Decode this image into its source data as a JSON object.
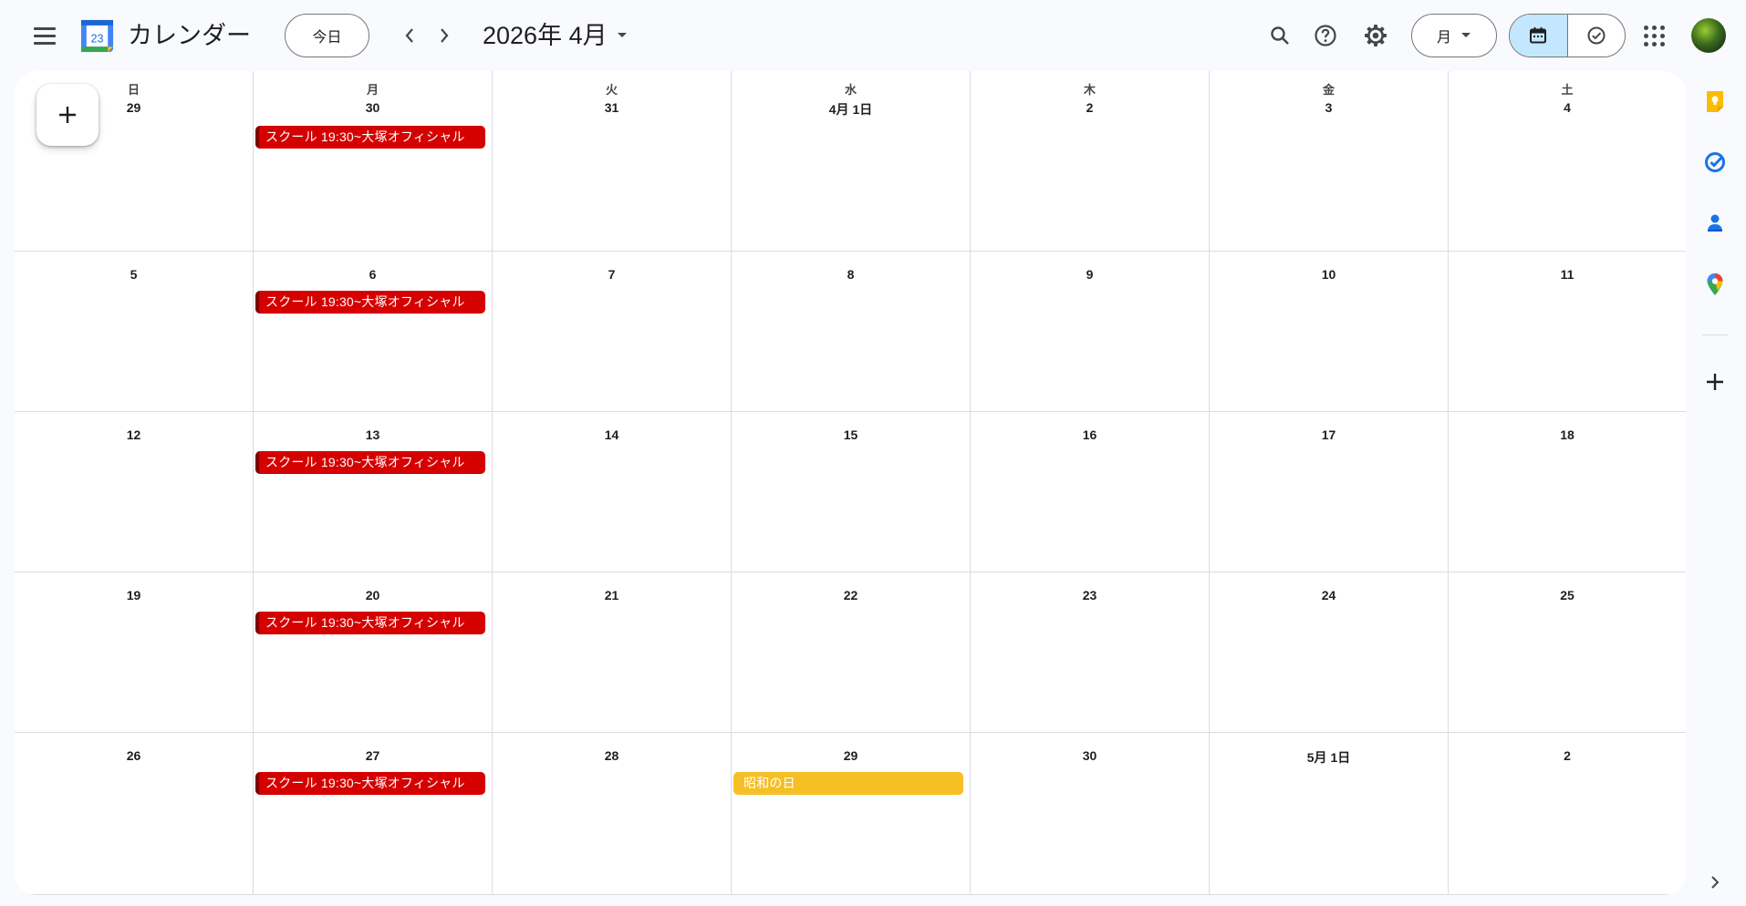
{
  "header": {
    "app_title": "カレンダー",
    "logo_day": "23",
    "today_label": "今日",
    "month_label": "2026年 4月",
    "view_label": "月",
    "icons": [
      "menu-icon",
      "search-icon",
      "help-icon",
      "settings-icon",
      "calendar-view-icon",
      "tasks-view-icon",
      "apps-icon"
    ]
  },
  "calendar": {
    "weekdays": [
      "日",
      "月",
      "火",
      "水",
      "木",
      "金",
      "土"
    ],
    "weeks": [
      [
        "29",
        "30",
        "31",
        "4月 1日",
        "2",
        "3",
        "4"
      ],
      [
        "5",
        "6",
        "7",
        "8",
        "9",
        "10",
        "11"
      ],
      [
        "12",
        "13",
        "14",
        "15",
        "16",
        "17",
        "18"
      ],
      [
        "19",
        "20",
        "21",
        "22",
        "23",
        "24",
        "25"
      ],
      [
        "26",
        "27",
        "28",
        "29",
        "30",
        "5月 1日",
        "2"
      ]
    ],
    "events": [
      {
        "week": 0,
        "day": 1,
        "title": "スクール 19:30~大塚オフィシャル",
        "color": "#d50000",
        "style": "red"
      },
      {
        "week": 1,
        "day": 1,
        "title": "スクール 19:30~大塚オフィシャル",
        "color": "#d50000",
        "style": "red"
      },
      {
        "week": 2,
        "day": 1,
        "title": "スクール 19:30~大塚オフィシャル",
        "color": "#d50000",
        "style": "red"
      },
      {
        "week": 3,
        "day": 1,
        "title": "スクール 19:30~大塚オフィシャル",
        "color": "#d50000",
        "style": "red"
      },
      {
        "week": 4,
        "day": 1,
        "title": "スクール 19:30~大塚オフィシャル",
        "color": "#d50000",
        "style": "red"
      },
      {
        "week": 4,
        "day": 3,
        "title": "昭和の日",
        "color": "#f6bf26",
        "style": "yellow"
      }
    ]
  },
  "sidebar": {
    "icons": [
      "keep-icon",
      "tasks-icon",
      "contacts-icon",
      "maps-icon",
      "add-addon-icon",
      "chevron-right-icon"
    ]
  },
  "colors": {
    "accent": "#0b57d0",
    "active_toggle": "#c2e7ff",
    "event_red": "#d50000",
    "event_yellow": "#f6bf26"
  }
}
